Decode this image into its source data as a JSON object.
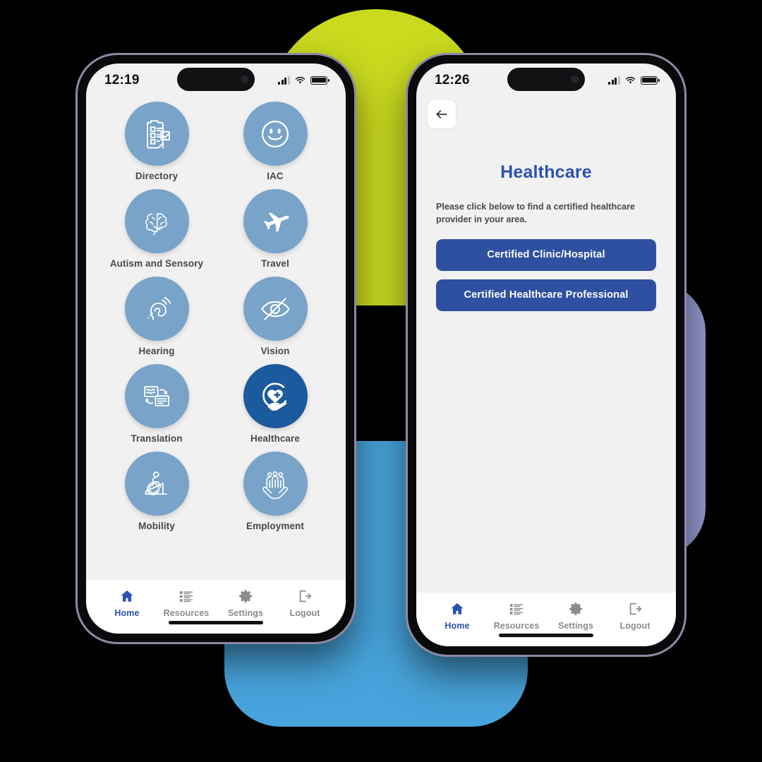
{
  "colors": {
    "accent_blue": "#2a52b0",
    "cta_blue": "#2f4fa0",
    "tile_light": "#79a3c8",
    "tile_dark": "#1c5a9e",
    "bg_yellow": "#cada1f",
    "bg_blue": "#47a3db",
    "bg_purple": "#9197cc",
    "screen_bg": "#f1f1f1"
  },
  "left_phone": {
    "status": {
      "clock": "12:19",
      "signal_icon": "cellular-bars-icon",
      "wifi_icon": "wifi-icon",
      "battery_icon": "battery-icon"
    },
    "grid": [
      {
        "label": "Directory",
        "icon": "clipboard-checklist-icon",
        "highlight": false
      },
      {
        "label": "IAC",
        "icon": "smiley-face-icon",
        "highlight": false
      },
      {
        "label": "Autism and Sensory",
        "icon": "brain-icon",
        "highlight": false
      },
      {
        "label": "Travel",
        "icon": "airplane-icon",
        "highlight": false
      },
      {
        "label": "Hearing",
        "icon": "ear-hearing-icon",
        "highlight": false
      },
      {
        "label": "Vision",
        "icon": "eye-slash-icon",
        "highlight": false
      },
      {
        "label": "Translation",
        "icon": "translation-swap-icon",
        "highlight": false
      },
      {
        "label": "Healthcare",
        "icon": "heart-hand-care-icon",
        "highlight": true
      },
      {
        "label": "Mobility",
        "icon": "wheelchair-ramp-icon",
        "highlight": false
      },
      {
        "label": "Employment",
        "icon": "people-in-hands-icon",
        "highlight": false
      }
    ],
    "tabs": [
      {
        "label": "Home",
        "icon": "home-icon",
        "active": true
      },
      {
        "label": "Resources",
        "icon": "list-icon",
        "active": false
      },
      {
        "label": "Settings",
        "icon": "gear-icon",
        "active": false
      },
      {
        "label": "Logout",
        "icon": "logout-icon",
        "active": false
      }
    ]
  },
  "right_phone": {
    "status": {
      "clock": "12:26",
      "signal_icon": "cellular-bars-icon",
      "wifi_icon": "wifi-icon",
      "battery_icon": "battery-icon"
    },
    "back_icon": "arrow-left-icon",
    "title": "Healthcare",
    "subtitle": "Please click below to find a certified healthcare provider in your area.",
    "buttons": [
      {
        "label": "Certified Clinic/Hospital"
      },
      {
        "label": "Certified Healthcare Professional"
      }
    ],
    "tabs": [
      {
        "label": "Home",
        "icon": "home-icon",
        "active": true
      },
      {
        "label": "Resources",
        "icon": "list-icon",
        "active": false
      },
      {
        "label": "Settings",
        "icon": "gear-icon",
        "active": false
      },
      {
        "label": "Logout",
        "icon": "logout-icon",
        "active": false
      }
    ]
  }
}
